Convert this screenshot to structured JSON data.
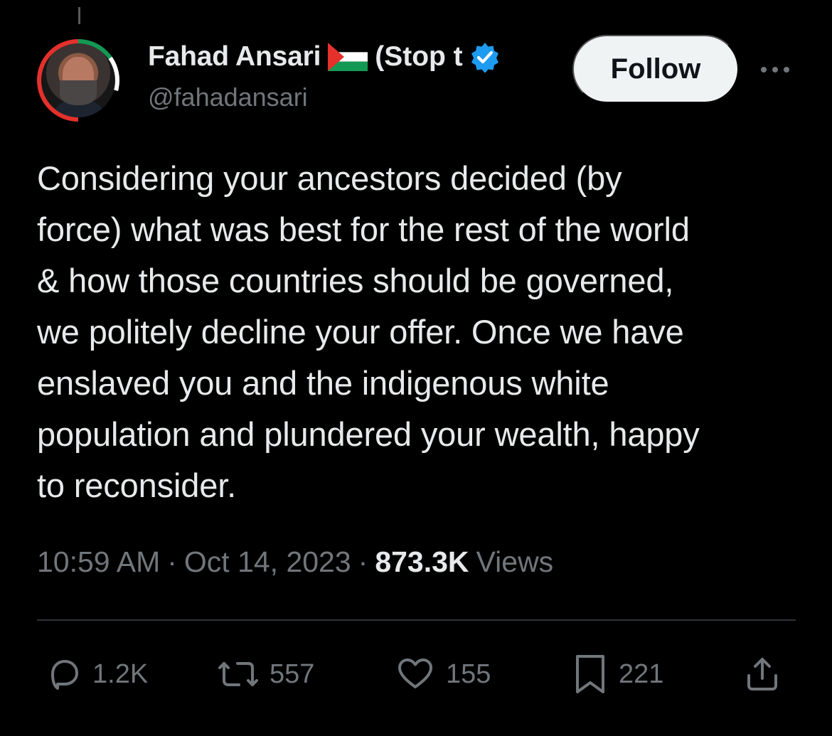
{
  "tweet": {
    "author": {
      "display_name": "Fahad Ansari",
      "flag_icon": "palestine-flag-icon",
      "name_suffix": "(Stop t",
      "verified_icon": "verified-badge-icon",
      "handle": "@fahadansari",
      "avatar": "profile-avatar"
    },
    "follow_label": "Follow",
    "more_icon": "more-options-icon",
    "text": "Considering your ancestors decided (by\nforce) what was best for the rest of the world\n& how those countries should be governed,\nwe politely decline your offer. Once we have\nenslaved you and the indigenous white\npopulation and plundered your wealth, happy\nto reconsider.",
    "meta": {
      "time": "10:59 AM",
      "separator": "·",
      "date": "Oct 14, 2023",
      "views_count": "873.3K",
      "views_label": "Views"
    },
    "actions": [
      {
        "name": "reply",
        "icon": "reply-icon",
        "count": "1.2K"
      },
      {
        "name": "repost",
        "icon": "repost-icon",
        "count": "557"
      },
      {
        "name": "like",
        "icon": "heart-icon",
        "count": "155"
      },
      {
        "name": "bookmark",
        "icon": "bookmark-icon",
        "count": "221"
      },
      {
        "name": "share",
        "icon": "share-icon",
        "count": ""
      }
    ]
  },
  "colors": {
    "background": "#000000",
    "primary_text": "#e7e9ea",
    "secondary_text": "#71767b",
    "verified_blue": "#1d9bf0",
    "divider": "#2f3336"
  }
}
